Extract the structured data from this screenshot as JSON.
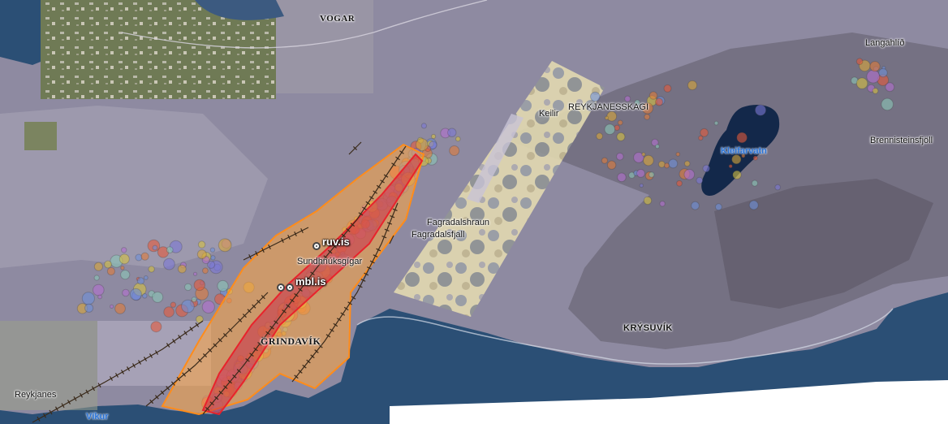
{
  "place_labels": {
    "vogar": "VOGAR",
    "langahlid": "Langahlíð",
    "keilir": "Keilir",
    "reykjanesskagi": "REYKJANESSKAGI",
    "kleifarvatn": "Kleifarvatn",
    "brennisteinsfjoll": "Brennisteinsfjöll",
    "fagradalshraun": "Fagradalshraun",
    "fagradalsfjall": "Fagradalsfjall",
    "sundhnuksgigar": "Sundhnúksgígar",
    "grindavik": "GRINDAVÍK",
    "krysuvik": "KRÝSUVÍK",
    "reykjanes": "Reykjanes",
    "vikur": "Víkur"
  },
  "markers": {
    "ruv": "ruv.is",
    "mbl": "mbl.is"
  },
  "colors": {
    "warning_zone_stroke": "#ff8c1a",
    "warning_zone_fill": "#ffa640",
    "fissure_zone": "#e8232c",
    "fault_line": "#3a2a1a",
    "sea": "#2b4f75",
    "lake": "#13284a"
  },
  "icons": {
    "webcam": "webcam-icon"
  }
}
